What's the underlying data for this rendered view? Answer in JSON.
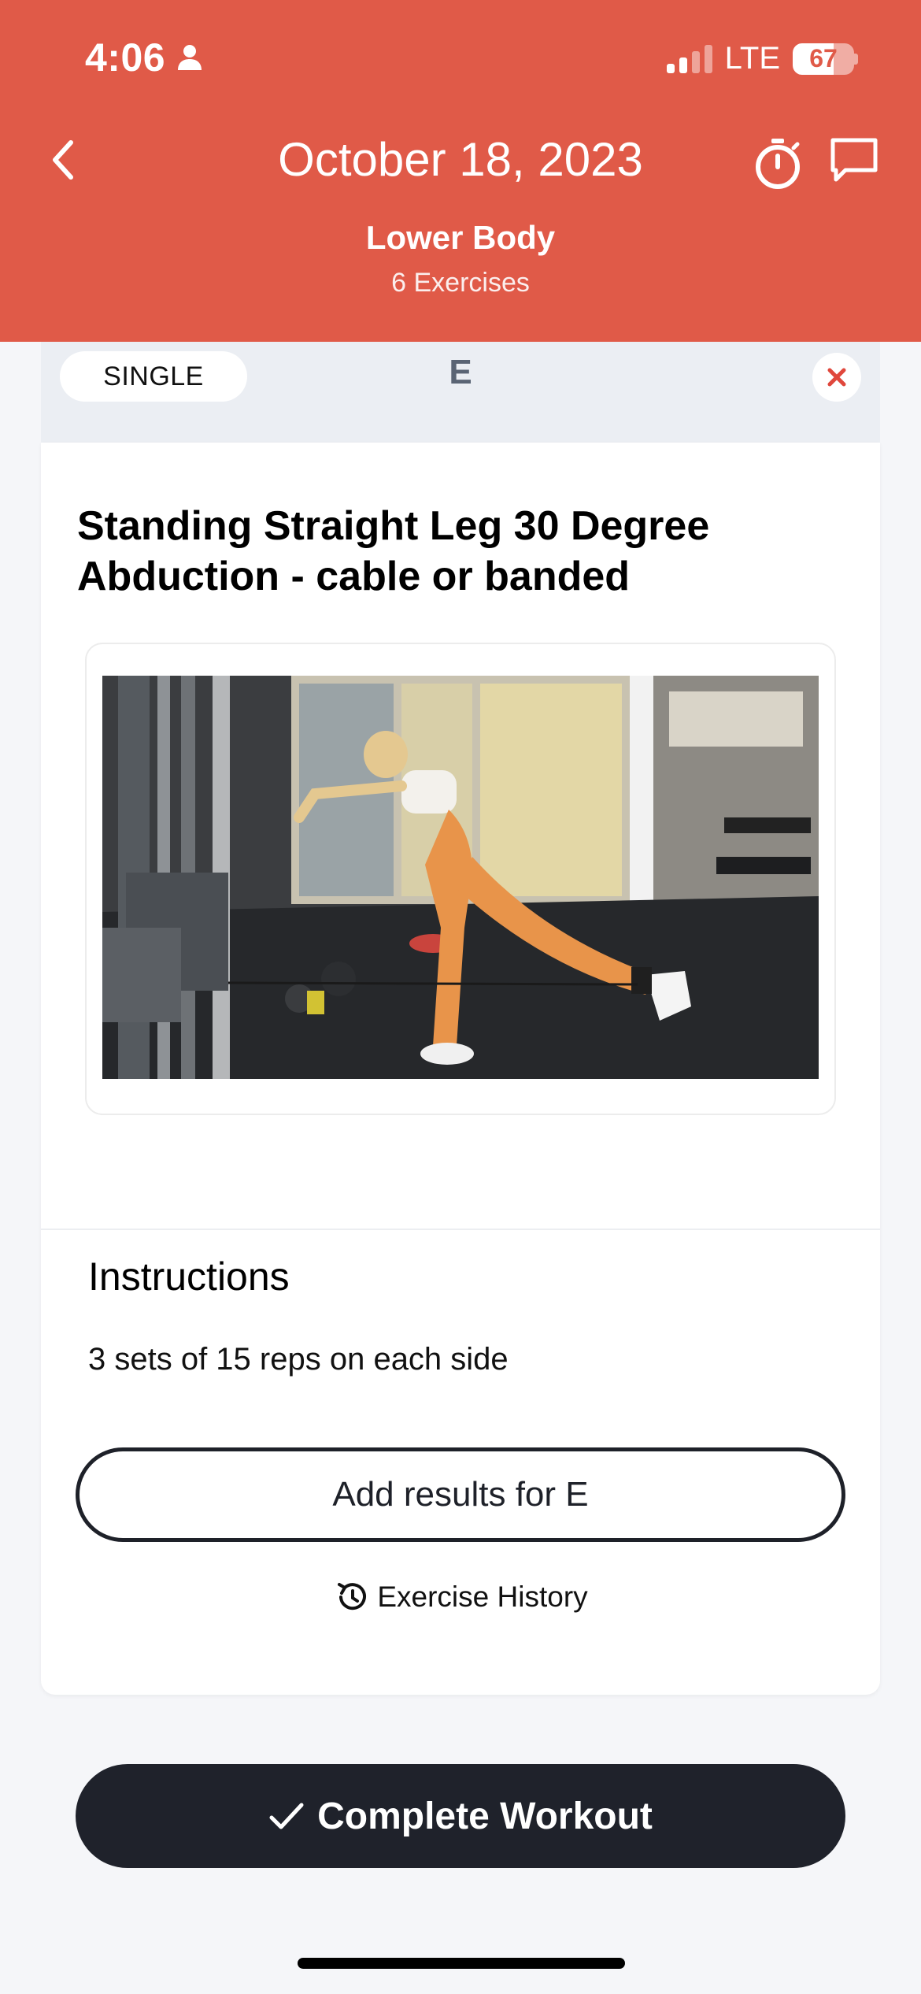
{
  "status_bar": {
    "time": "4:06",
    "network": "LTE",
    "battery": "67",
    "battery_level": 0.67
  },
  "header": {
    "date_title": "October 18, 2023",
    "workout_name": "Lower Body",
    "exercise_count": "6 Exercises",
    "back_icon": "chevron-left-icon",
    "timer_icon": "stopwatch-icon",
    "chat_icon": "chat-bubble-icon"
  },
  "exercise_card": {
    "type_label": "SINGLE",
    "letter": "E",
    "title": "Standing Straight Leg 30 Degree Abduction - cable or banded",
    "instructions_heading": "Instructions",
    "instructions_text": "3 sets of 15 reps on each side",
    "add_results_label": "Add results for E",
    "history_label": "Exercise History"
  },
  "footer": {
    "complete_label": "Complete Workout"
  },
  "colors": {
    "header_bg": "#e05a48",
    "close_x": "#e0473c",
    "dark_button": "#1f222b"
  }
}
